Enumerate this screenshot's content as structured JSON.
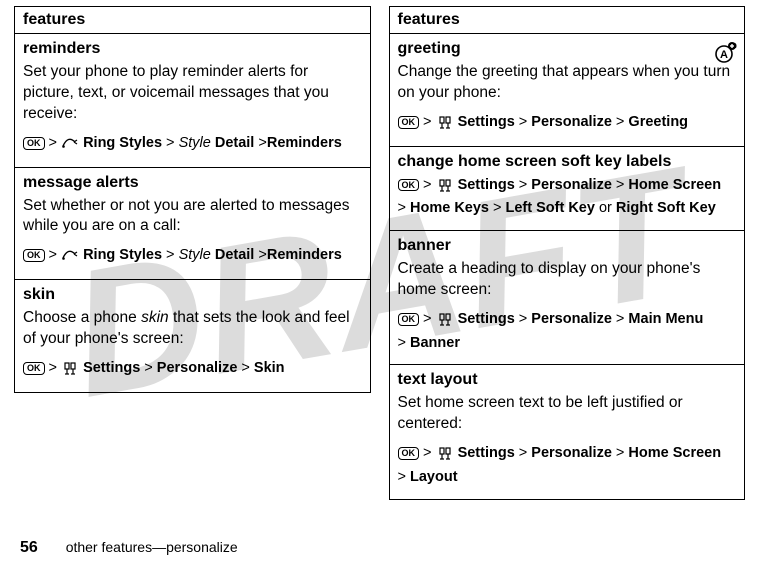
{
  "watermark": "DRAFT",
  "col_header": "features",
  "left": [
    {
      "title": "reminders",
      "desc": "Set your phone to play reminder alerts for picture, text, or voicemail messages that you receive:",
      "path_html": "<span class='ok-key'>OK</span> &gt; <span class='icon-holder ring-icon'><svg width='16' height='14' viewBox='0 0 16 14'><path d='M1 9 Q6 -2 13 5' stroke='#000' stroke-width='1.4' fill='none'/><circle cx='1.5' cy='9.5' r='1.3' fill='#000'/><path d='M12 5 L15 3 M12 5 L15 7' stroke='#000' stroke-width='1.2' fill='none'/></svg></span> <span class='bold'>Ring Styles</span> &gt; <span class='italic'>Style</span> <span class='bold'>Detail</span> &gt;<span class='bold'>Reminders</span>"
    },
    {
      "title": "message alerts",
      "desc": "Set whether or not you are alerted to messages while you are on a call:",
      "path_html": "<span class='ok-key'>OK</span> &gt; <span class='icon-holder ring-icon'><svg width='16' height='14' viewBox='0 0 16 14'><path d='M1 9 Q6 -2 13 5' stroke='#000' stroke-width='1.4' fill='none'/><circle cx='1.5' cy='9.5' r='1.3' fill='#000'/><path d='M12 5 L15 3 M12 5 L15 7' stroke='#000' stroke-width='1.2' fill='none'/></svg></span> <span class='bold'>Ring Styles</span> &gt; <span class='italic'>Style</span> <span class='bold'>Detail</span> &gt;<span class='bold'>Reminders</span>"
    },
    {
      "title": "skin",
      "desc_html": "Choose a phone <i>skin</i> that sets the look and feel of your phone's screen:",
      "path_html": "<span class='ok-key'>OK</span> &gt; <span class='icon-holder settings-icon'><svg width='14' height='14' viewBox='0 0 14 14'><rect x='2' y='1' width='4' height='6' stroke='#000' stroke-width='1.2' fill='none'/><rect x='8' y='1' width='4' height='6' stroke='#000' stroke-width='1.2' fill='none'/><line x1='4' y1='7' x2='4' y2='12' stroke='#000' stroke-width='1.2'/><line x1='10' y1='7' x2='10' y2='12' stroke='#000' stroke-width='1.2'/><line x1='2' y1='12' x2='6' y2='12' stroke='#000' stroke-width='1.2'/><line x1='8' y1='12' x2='12' y2='12' stroke='#000' stroke-width='1.2'/></svg></span> <span class='bold'>Settings</span> &gt; <span class='bold'>Personalize</span> &gt; <span class='bold'>Skin</span>"
    }
  ],
  "right": [
    {
      "title": "greeting",
      "desc": "Change the greeting that appears when you turn on your phone:",
      "has_corner_icon": true,
      "path_html": "<span class='ok-key'>OK</span> &gt; <span class='icon-holder settings-icon'><svg width='14' height='14' viewBox='0 0 14 14'><rect x='2' y='1' width='4' height='6' stroke='#000' stroke-width='1.2' fill='none'/><rect x='8' y='1' width='4' height='6' stroke='#000' stroke-width='1.2' fill='none'/><line x1='4' y1='7' x2='4' y2='12' stroke='#000' stroke-width='1.2'/><line x1='10' y1='7' x2='10' y2='12' stroke='#000' stroke-width='1.2'/><line x1='2' y1='12' x2='6' y2='12' stroke='#000' stroke-width='1.2'/><line x1='8' y1='12' x2='12' y2='12' stroke='#000' stroke-width='1.2'/></svg></span> <span class='bold'>Settings</span> &gt; <span class='bold'>Personalize</span> &gt; <span class='bold'>Greeting</span>"
    },
    {
      "title": "change home screen soft key labels",
      "path_html": "<span class='ok-key'>OK</span> &gt; <span class='icon-holder settings-icon'><svg width='14' height='14' viewBox='0 0 14 14'><rect x='2' y='1' width='4' height='6' stroke='#000' stroke-width='1.2' fill='none'/><rect x='8' y='1' width='4' height='6' stroke='#000' stroke-width='1.2' fill='none'/><line x1='4' y1='7' x2='4' y2='12' stroke='#000' stroke-width='1.2'/><line x1='10' y1='7' x2='10' y2='12' stroke='#000' stroke-width='1.2'/><line x1='2' y1='12' x2='6' y2='12' stroke='#000' stroke-width='1.2'/><line x1='8' y1='12' x2='12' y2='12' stroke='#000' stroke-width='1.2'/></svg></span> <span class='bold'>Settings</span> &gt; <span class='bold'>Personalize</span> &gt; <span class='bold'>Home Screen</span> &gt;&nbsp;<span class='bold'>Home Keys</span> &gt; <span class='bold'>Left Soft Key</span> or <span class='bold'>Right Soft Key</span>"
    },
    {
      "title": "banner",
      "desc": "Create a heading to display on your phone's home screen:",
      "path_html": "<span class='ok-key'>OK</span> &gt; <span class='icon-holder settings-icon'><svg width='14' height='14' viewBox='0 0 14 14'><rect x='2' y='1' width='4' height='6' stroke='#000' stroke-width='1.2' fill='none'/><rect x='8' y='1' width='4' height='6' stroke='#000' stroke-width='1.2' fill='none'/><line x1='4' y1='7' x2='4' y2='12' stroke='#000' stroke-width='1.2'/><line x1='10' y1='7' x2='10' y2='12' stroke='#000' stroke-width='1.2'/><line x1='2' y1='12' x2='6' y2='12' stroke='#000' stroke-width='1.2'/><line x1='8' y1='12' x2='12' y2='12' stroke='#000' stroke-width='1.2'/></svg></span> <span class='bold'>Settings</span> &gt; <span class='bold'>Personalize</span> &gt; <span class='bold'>Main Menu</span> &gt;&nbsp;<span class='bold'>Banner</span>"
    },
    {
      "title": "text layout",
      "desc": "Set home screen text to be left justified or centered:",
      "path_html": "<span class='ok-key'>OK</span> &gt; <span class='icon-holder settings-icon'><svg width='14' height='14' viewBox='0 0 14 14'><rect x='2' y='1' width='4' height='6' stroke='#000' stroke-width='1.2' fill='none'/><rect x='8' y='1' width='4' height='6' stroke='#000' stroke-width='1.2' fill='none'/><line x1='4' y1='7' x2='4' y2='12' stroke='#000' stroke-width='1.2'/><line x1='10' y1='7' x2='10' y2='12' stroke='#000' stroke-width='1.2'/><line x1='2' y1='12' x2='6' y2='12' stroke='#000' stroke-width='1.2'/><line x1='8' y1='12' x2='12' y2='12' stroke='#000' stroke-width='1.2'/></svg></span> <span class='bold'>Settings</span> &gt; <span class='bold'>Personalize</span> &gt; <span class='bold'>Home Screen</span> &gt;&nbsp;<span class='bold'>Layout</span>"
    }
  ],
  "footer": {
    "page": "56",
    "text": "other features—personalize"
  }
}
